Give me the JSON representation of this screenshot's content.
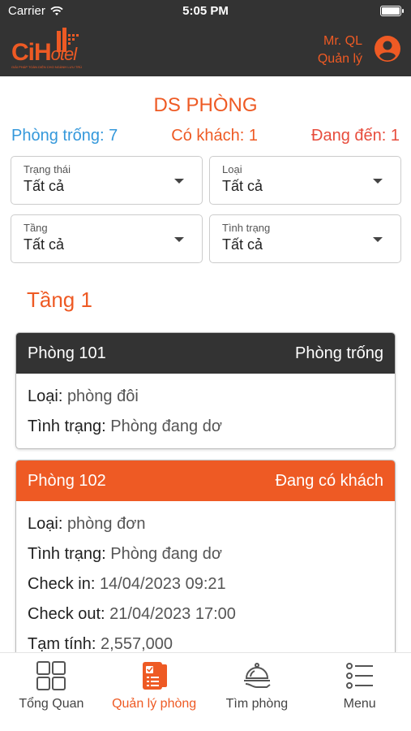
{
  "status_bar": {
    "carrier": "Carrier",
    "time": "5:05 PM"
  },
  "header": {
    "logo_ci": "Ci",
    "logo_h": "H",
    "logo_otel": "otel",
    "logo_slogan": "GIẢI PHÁP TOÀN DIỆN CHO NGÀNH LƯU TRÚ",
    "user_name": "Mr. QL",
    "user_role": "Quản lý"
  },
  "page": {
    "title": "DS PHÒNG",
    "counts": {
      "free": "Phòng trống: 7",
      "guest": "Có khách: 1",
      "arriving": "Đang đến: 1"
    }
  },
  "filters": [
    {
      "label": "Trạng thái",
      "value": "Tất cả"
    },
    {
      "label": "Loại",
      "value": "Tất cả"
    },
    {
      "label": "Tầng",
      "value": "Tất cả"
    },
    {
      "label": "Tình trạng",
      "value": "Tất cả"
    }
  ],
  "floor": {
    "title": "Tầng 1"
  },
  "rooms": [
    {
      "name": "Phòng 101",
      "status": "Phòng trống",
      "type_label": "Loại:",
      "type": "phòng đôi",
      "cond_label": "Tình trạng:",
      "cond": "Phòng đang dơ"
    },
    {
      "name": "Phòng 102",
      "status": "Đang có khách",
      "type_label": "Loại:",
      "type": "phòng đơn",
      "cond_label": "Tình trạng:",
      "cond": "Phòng đang dơ",
      "checkin_label": "Check in:",
      "checkin": "14/04/2023 09:21",
      "checkout_label": "Check out:",
      "checkout": "21/04/2023 17:00",
      "subtotal_label": "Tạm tính:",
      "subtotal": "2,557,000"
    }
  ],
  "tabs": [
    {
      "label": "Tổng Quan",
      "icon": "grid-icon"
    },
    {
      "label": "Quản lý phòng",
      "icon": "room-list-icon",
      "active": true
    },
    {
      "label": "Tìm phòng",
      "icon": "cloche-icon"
    },
    {
      "label": "Menu",
      "icon": "menu-list-icon"
    }
  ],
  "colors": {
    "accent": "#ee5a24",
    "dark": "#333333",
    "free": "#3498db",
    "arriving": "#e74c3c"
  }
}
